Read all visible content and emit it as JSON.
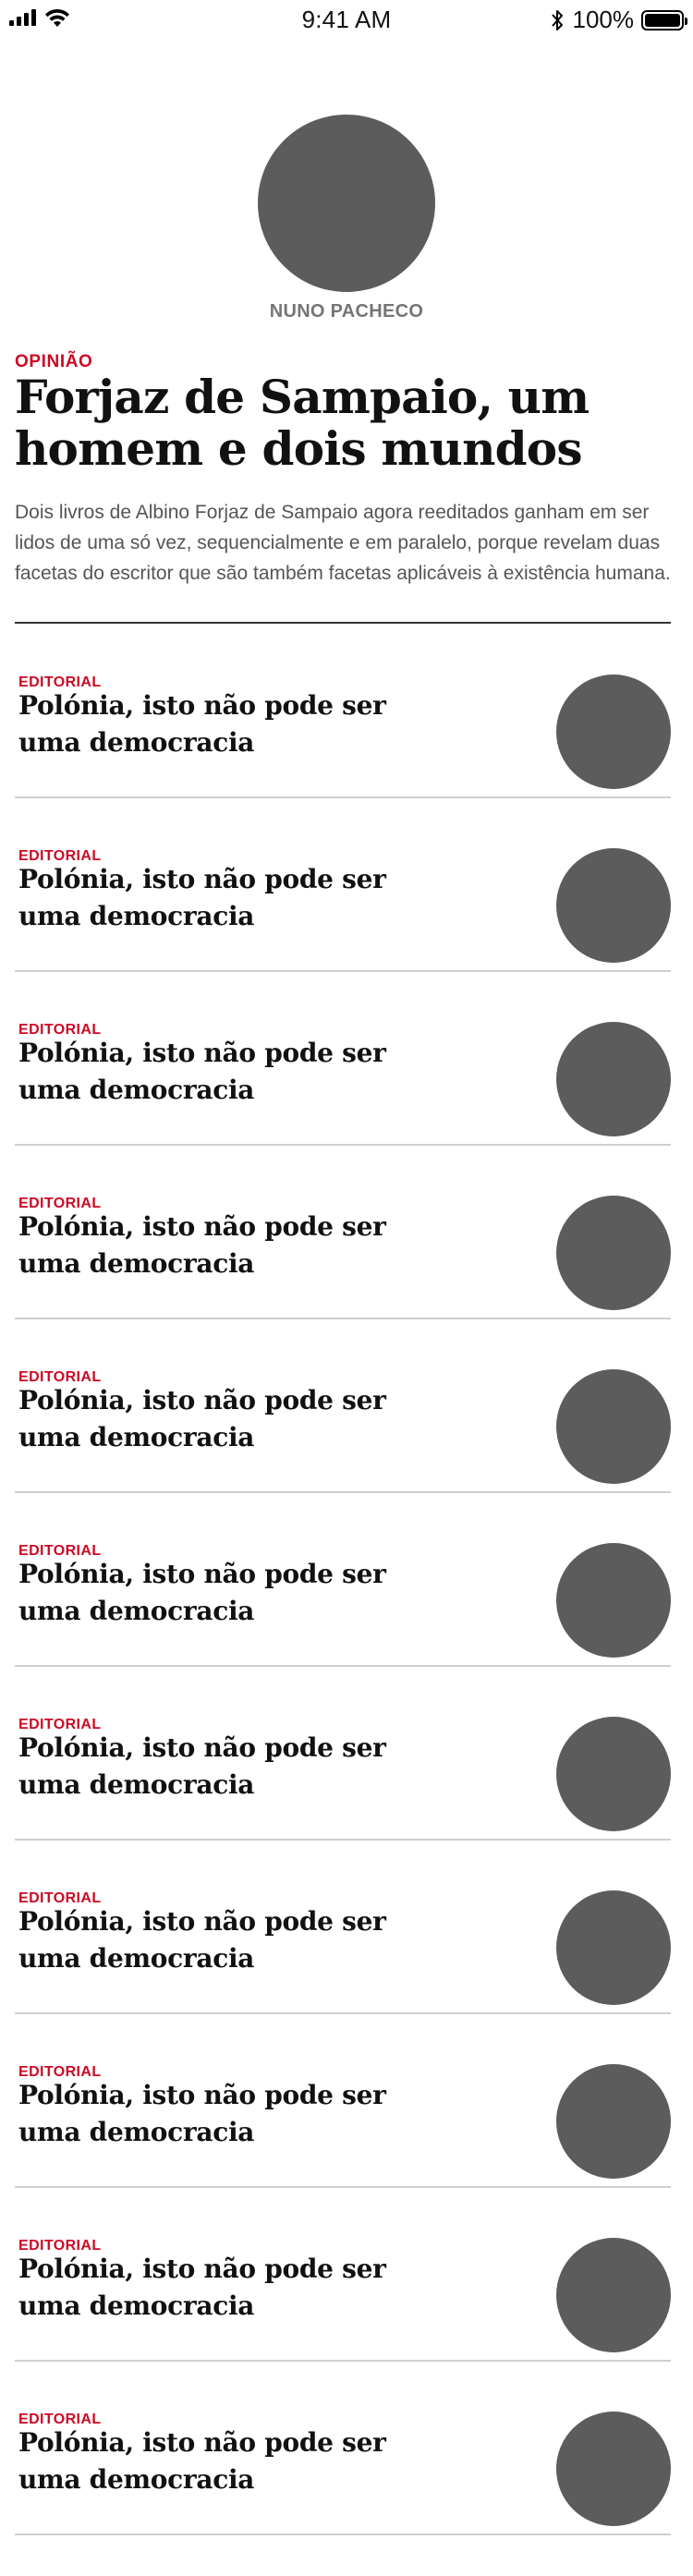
{
  "status_bar": {
    "time": "9:41 AM",
    "battery": "100%"
  },
  "author": {
    "name": "NUNO PACHECO"
  },
  "article": {
    "section": "OPINIÃO",
    "title": "Forjaz de Sampaio, um homem e dois mundos",
    "lead": "Dois livros de Albino Forjaz de Sampaio agora reeditados ganham em ser lidos de uma só vez, sequencialmente e em paralelo, porque revelam duas facetas do escritor que são também facetas aplicáveis à existência humana."
  },
  "stories": [
    {
      "kicker": "EDITORIAL",
      "title": "Polónia, isto não pode ser uma democracia"
    },
    {
      "kicker": "EDITORIAL",
      "title": "Polónia, isto não pode ser uma democracia"
    },
    {
      "kicker": "EDITORIAL",
      "title": "Polónia, isto não pode ser uma democracia"
    },
    {
      "kicker": "EDITORIAL",
      "title": "Polónia, isto não pode ser uma democracia"
    },
    {
      "kicker": "EDITORIAL",
      "title": "Polónia, isto não pode ser uma democracia"
    },
    {
      "kicker": "EDITORIAL",
      "title": "Polónia, isto não pode ser uma democracia"
    },
    {
      "kicker": "EDITORIAL",
      "title": "Polónia, isto não pode ser uma democracia"
    },
    {
      "kicker": "EDITORIAL",
      "title": "Polónia, isto não pode ser uma democracia"
    },
    {
      "kicker": "EDITORIAL",
      "title": "Polónia, isto não pode ser uma democracia"
    },
    {
      "kicker": "EDITORIAL",
      "title": "Polónia, isto não pode ser uma democracia"
    },
    {
      "kicker": "EDITORIAL",
      "title": "Polónia, isto não pode ser uma democracia"
    }
  ],
  "colors": {
    "accent": "#cc0a24",
    "placeholder": "#5c5c5c",
    "divider": "#cfcfcf"
  },
  "icons": [
    "signal-icon",
    "wifi-icon",
    "bluetooth-icon",
    "battery-icon"
  ]
}
